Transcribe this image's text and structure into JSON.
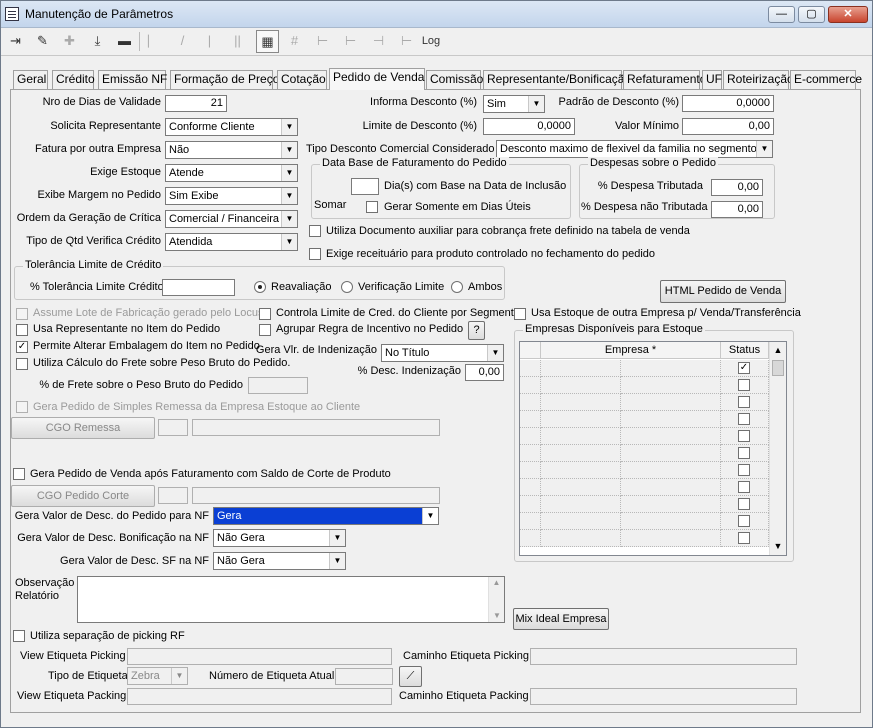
{
  "window": {
    "title": "Manutenção de Parâmetros",
    "minimize": "—",
    "maximize": "▢",
    "close": "✕"
  },
  "toolbar": {
    "log_label": "Log"
  },
  "tabs": [
    "Geral",
    "Crédito",
    "Emissão NF",
    "Formação de Preço",
    "Cotação",
    "Pedido de Venda",
    "Comissão",
    "Representante/Bonificação",
    "Refaturamento",
    "UF",
    "Roteirização",
    "E-commerce"
  ],
  "left": {
    "nro_dias_label": "Nro de Dias de Validade",
    "nro_dias_value": "21",
    "solicita_rep_label": "Solicita Representante",
    "solicita_rep_value": "Conforme Cliente",
    "fatura_outra_label": "Fatura por outra Empresa",
    "fatura_outra_value": "Não",
    "exige_estoque_label": "Exige Estoque",
    "exige_estoque_value": "Atende",
    "exibe_margem_label": "Exibe Margem no Pedido",
    "exibe_margem_value": "Sim Exibe",
    "ordem_critica_label": "Ordem da Geração de Crítica",
    "ordem_critica_value": "Comercial / Financeira",
    "tipo_qtd_label": "Tipo de Qtd Verifica Crédito",
    "tipo_qtd_value": "Atendida"
  },
  "right": {
    "informa_desc_label": "Informa Desconto (%)",
    "informa_desc_value": "Sim",
    "padrao_desc_label": "Padrão de Desconto (%)",
    "padrao_desc_value": "0,0000",
    "limite_desc_label": "Limite de Desconto (%)",
    "limite_desc_value": "0,0000",
    "valor_min_label": "Valor Mínimo",
    "valor_min_value": "0,00",
    "tipo_desc_label": "Tipo Desconto Comercial Considerado",
    "tipo_desc_value": "Desconto maximo de flexivel da familia no segmento"
  },
  "data_base": {
    "title": "Data Base de Faturamento do Pedido",
    "somar": "Somar",
    "dias_label": "Dia(s)  com Base na Data de Inclusão",
    "dias_value": "",
    "uteis_label": "Gerar Somente em Dias Úteis"
  },
  "despesas": {
    "title": "Despesas sobre o Pedido",
    "trib_label": "% Despesa Tributada",
    "trib_value": "0,00",
    "nao_trib_label": "% Despesa não Tributada",
    "nao_trib_value": "0,00"
  },
  "checks_mid": {
    "doc_aux": "Utiliza Documento auxiliar para cobrança frete definido na tabela de venda",
    "receituario": "Exige receituário para produto controlado no fechamento do pedido"
  },
  "tolerancia": {
    "title": "Tolerância Limite de Crédito",
    "pct_label": "% Tolerância Limite Crédito",
    "pct_value": "",
    "opt1": "Reavaliação",
    "opt2": "Verificação Limite",
    "opt3": "Ambos"
  },
  "html_button": "HTML Pedido de Venda",
  "checks": {
    "assume_lote": "Assume Lote de Fabricação gerado pelo Locus",
    "controla_limite": "Controla Limite de Cred. do Cliente por Segmento",
    "usa_estoque_outra": "Usa Estoque de outra Empresa p/ Venda/Transferência",
    "usa_rep_item": "Usa Representante no Item do Pedido",
    "agrupar_regra": "Agrupar Regra de Incentivo no Pedido",
    "help": "?",
    "permite_alterar": "Permite Alterar Embalagem do Item no Pedido",
    "utiliza_calculo": "Utiliza Cálculo do Frete sobre Peso Bruto do Pedido.",
    "gera_simples": "Gera Pedido de Simples Remessa da Empresa Estoque ao Cliente",
    "gera_apos_fat": "Gera Pedido de Venda após Faturamento com Saldo de Corte de Produto",
    "picking_rf": "Utiliza separação de picking RF",
    "checkmark": "✓"
  },
  "gera_vlr": {
    "label": "Gera Vlr. de Indenização",
    "value": "No Título",
    "pct_label": "% Desc. Indenização",
    "pct_value": "0,00"
  },
  "frete_label": "% de Frete sobre o Peso Bruto do Pedido",
  "cgo_remessa": "CGO Remessa",
  "cgo_corte": "CGO Pedido Corte",
  "gera_desc": {
    "pedido_label": "Gera Valor de Desc. do Pedido para NF",
    "pedido_value": "Gera",
    "bonif_label": "Gera Valor de Desc. Bonificação na NF",
    "bonif_value": "Não Gera",
    "sf_label": "Gera Valor de Desc. SF na NF",
    "sf_value": "Não Gera"
  },
  "empresas": {
    "title": "Empresas Disponíveis para Estoque",
    "col_empresa": "Empresa *",
    "col_status": "Status",
    "first_checked": true
  },
  "obs_label_1": "Observação",
  "obs_label_2": "Relatório",
  "mix_button": "Mix Ideal Empresa",
  "etiqueta": {
    "view_picking": "View Etiqueta Picking",
    "caminho_picking": "Caminho Etiqueta Picking",
    "tipo_label": "Tipo de Etiqueta",
    "tipo_value": "Zebra",
    "numero_label": "Número de Etiqueta Atual",
    "view_packing": "View Etiqueta Packing",
    "caminho_packing": "Caminho Etiqueta Packing"
  }
}
